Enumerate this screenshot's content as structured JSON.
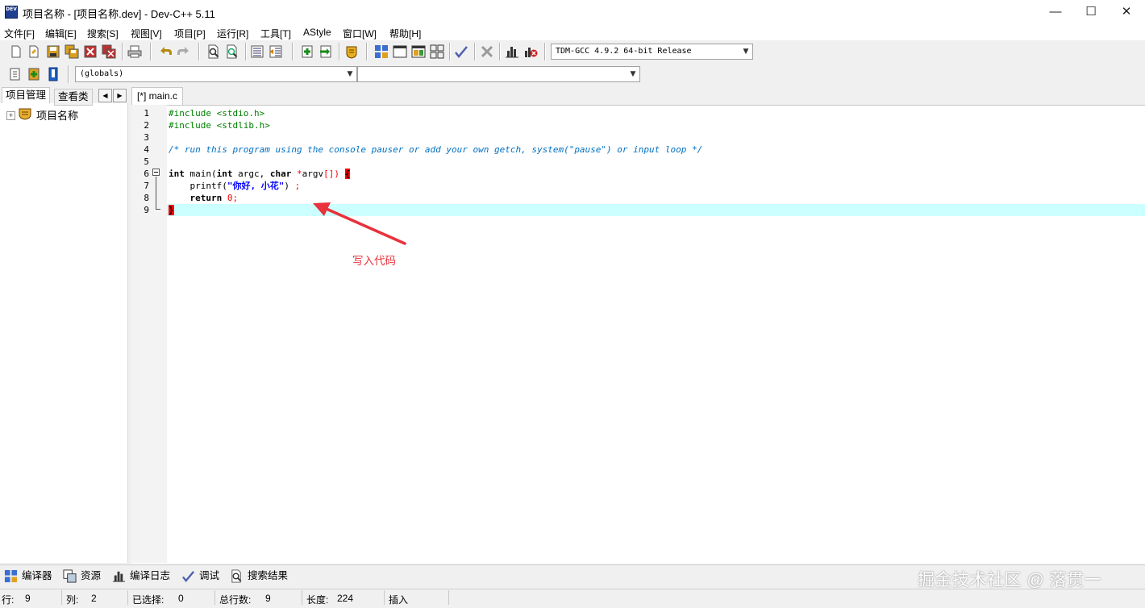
{
  "window": {
    "title": "项目名称 - [项目名称.dev] - Dev-C++ 5.11",
    "app_icon_text": "DEV",
    "minimize": "—",
    "maximize": "☐",
    "close": "✕"
  },
  "menu": [
    "文件[F]",
    "编辑[E]",
    "搜索[S]",
    "视图[V]",
    "项目[P]",
    "运行[R]",
    "工具[T]",
    "AStyle",
    "窗口[W]",
    "帮助[H]"
  ],
  "toolbar": {
    "compiler_select": "TDM-GCC 4.9.2 64-bit Release",
    "scope_select": "(globals)",
    "member_select": ""
  },
  "left_panel": {
    "tabs": [
      "项目管理",
      "查看类"
    ],
    "tree_root": "项目名称",
    "expand_glyph": "+"
  },
  "editor": {
    "tab_label": "[*] main.c",
    "line_numbers": [
      "1",
      "2",
      "3",
      "4",
      "5",
      "6",
      "7",
      "8",
      "9"
    ],
    "lines": {
      "l1": "#include <stdio.h>",
      "l2": "#include <stdlib.h>",
      "l4": "/* run this program using the console pauser or add your own getch, system(\"pause\") or input loop */",
      "l6_kw1": "int",
      "l6_a": " main(",
      "l6_kw2": "int",
      "l6_b": " argc, ",
      "l6_kw3": "char",
      "l6_c": " ",
      "l6_star": "*",
      "l6_d": "argv",
      "l6_e": "[])",
      "l6_brace": "{",
      "l7_a": "    printf(",
      "l7_str": "\"你好, 小花\"",
      "l7_b": ") ",
      "l7_semi": ";",
      "l8_kw": "    return",
      "l8_sp": " ",
      "l8_num": "0",
      "l8_semi": ";",
      "l9_brace": "}"
    },
    "annotation": "写入代码",
    "annotation_color": "#e8323c"
  },
  "bottom_tabs": [
    "编译器",
    "资源",
    "编译日志",
    "调试",
    "搜索结果"
  ],
  "watermark": "掘金技术社区 @ 落贯一",
  "status": {
    "row_label": "行:",
    "row_value": "9",
    "col_label": "列:",
    "col_value": "2",
    "sel_label": "已选择:",
    "sel_value": "0",
    "total_label": "总行数:",
    "total_value": "9",
    "len_label": "长度:",
    "len_value": "224",
    "mode": "插入"
  }
}
